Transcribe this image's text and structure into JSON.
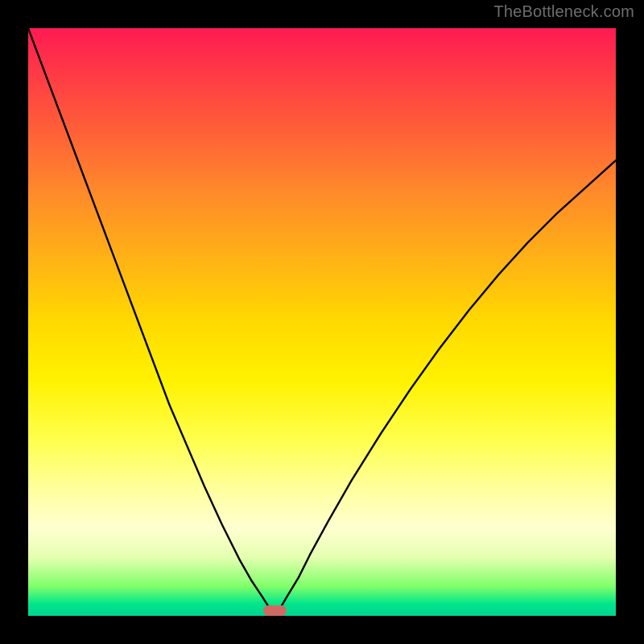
{
  "watermark": "TheBottleneck.com",
  "colors": {
    "curve": "#000000",
    "marker": "#cf6a63",
    "frame": "#000000"
  },
  "chart_data": {
    "type": "line",
    "title": "",
    "xlabel": "",
    "ylabel": "",
    "xlim": [
      0,
      100
    ],
    "ylim": [
      0,
      100
    ],
    "grid": false,
    "marker": {
      "x": 42,
      "y": 0,
      "width_pct": 4.0,
      "height_pct": 1.8
    },
    "series": [
      {
        "name": "left-branch",
        "x": [
          0,
          3,
          6,
          9,
          12,
          15,
          18,
          21,
          24,
          27,
          30,
          33,
          36,
          38,
          40,
          41,
          42
        ],
        "y": [
          100,
          92,
          84,
          76,
          68,
          60,
          52,
          44,
          36,
          29,
          22,
          15.5,
          9.5,
          6,
          3,
          1.4,
          0.3
        ]
      },
      {
        "name": "right-branch",
        "x": [
          42,
          43,
          44,
          46,
          48,
          51,
          55,
          60,
          65,
          70,
          75,
          80,
          85,
          90,
          95,
          100
        ],
        "y": [
          0.3,
          1.5,
          3.2,
          6.5,
          10.5,
          16,
          23,
          31,
          38.5,
          45.5,
          52,
          58,
          63.5,
          68.5,
          73,
          77.5
        ]
      }
    ]
  }
}
